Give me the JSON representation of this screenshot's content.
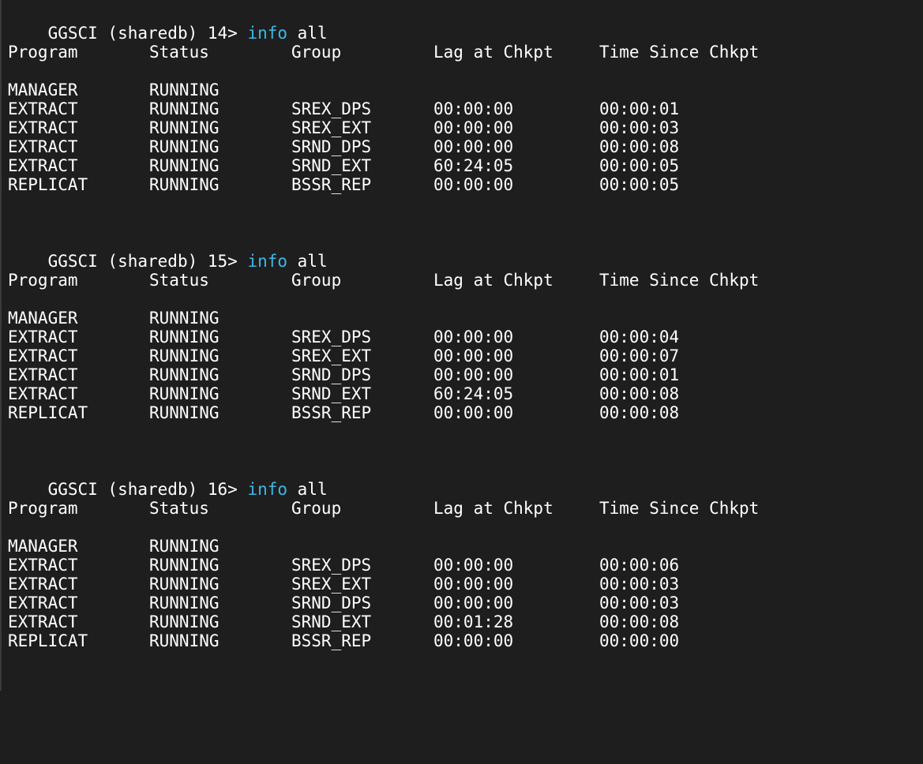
{
  "colors": {
    "background": "#1e1e1e",
    "text": "#ffffff",
    "command": "#3db8e6"
  },
  "blocks": [
    {
      "prompt": "GGSCI (sharedb) 14> ",
      "command": "info",
      "args": " all",
      "headers": [
        "Program",
        "Status",
        "Group",
        "Lag at Chkpt",
        "Time Since Chkpt"
      ],
      "rows": [
        [
          "MANAGER",
          "RUNNING",
          "",
          "",
          ""
        ],
        [
          "EXTRACT",
          "RUNNING",
          "SREX_DPS",
          "00:00:00",
          "00:00:01"
        ],
        [
          "EXTRACT",
          "RUNNING",
          "SREX_EXT",
          "00:00:00",
          "00:00:03"
        ],
        [
          "EXTRACT",
          "RUNNING",
          "SRND_DPS",
          "00:00:00",
          "00:00:08"
        ],
        [
          "EXTRACT",
          "RUNNING",
          "SRND_EXT",
          "60:24:05",
          "00:00:05"
        ],
        [
          "REPLICAT",
          "RUNNING",
          "BSSR_REP",
          "00:00:00",
          "00:00:05"
        ]
      ]
    },
    {
      "prompt": "GGSCI (sharedb) 15> ",
      "command": "info",
      "args": " all",
      "headers": [
        "Program",
        "Status",
        "Group",
        "Lag at Chkpt",
        "Time Since Chkpt"
      ],
      "rows": [
        [
          "MANAGER",
          "RUNNING",
          "",
          "",
          ""
        ],
        [
          "EXTRACT",
          "RUNNING",
          "SREX_DPS",
          "00:00:00",
          "00:00:04"
        ],
        [
          "EXTRACT",
          "RUNNING",
          "SREX_EXT",
          "00:00:00",
          "00:00:07"
        ],
        [
          "EXTRACT",
          "RUNNING",
          "SRND_DPS",
          "00:00:00",
          "00:00:01"
        ],
        [
          "EXTRACT",
          "RUNNING",
          "SRND_EXT",
          "60:24:05",
          "00:00:08"
        ],
        [
          "REPLICAT",
          "RUNNING",
          "BSSR_REP",
          "00:00:00",
          "00:00:08"
        ]
      ]
    },
    {
      "prompt": "GGSCI (sharedb) 16> ",
      "command": "info",
      "args": " all",
      "headers": [
        "Program",
        "Status",
        "Group",
        "Lag at Chkpt",
        "Time Since Chkpt"
      ],
      "rows": [
        [
          "MANAGER",
          "RUNNING",
          "",
          "",
          ""
        ],
        [
          "EXTRACT",
          "RUNNING",
          "SREX_DPS",
          "00:00:00",
          "00:00:06"
        ],
        [
          "EXTRACT",
          "RUNNING",
          "SREX_EXT",
          "00:00:00",
          "00:00:03"
        ],
        [
          "EXTRACT",
          "RUNNING",
          "SRND_DPS",
          "00:00:00",
          "00:00:03"
        ],
        [
          "EXTRACT",
          "RUNNING",
          "SRND_EXT",
          "00:01:28",
          "00:00:08"
        ],
        [
          "REPLICAT",
          "RUNNING",
          "BSSR_REP",
          "00:00:00",
          "00:00:00"
        ]
      ]
    }
  ]
}
